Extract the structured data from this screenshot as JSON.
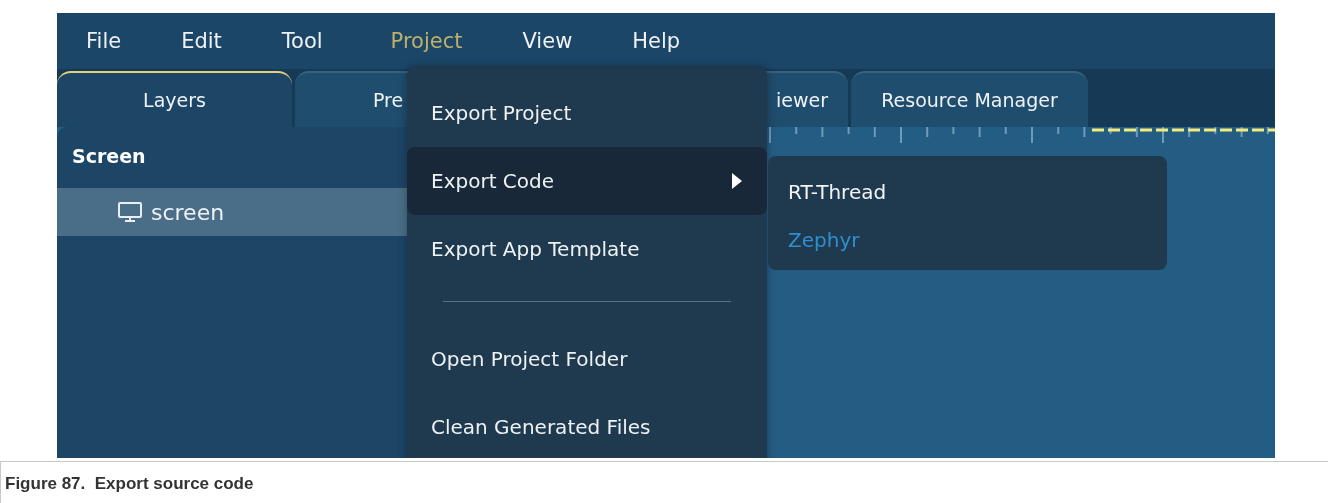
{
  "menubar": [
    {
      "label": "File",
      "selected": false
    },
    {
      "label": "Edit",
      "selected": false
    },
    {
      "label": "Tool",
      "selected": false
    },
    {
      "label": "Project",
      "selected": true
    },
    {
      "label": "View",
      "selected": false
    },
    {
      "label": "Help",
      "selected": false
    }
  ],
  "tabs": [
    {
      "label": "Layers",
      "selected": true
    },
    {
      "label": "Pre",
      "selected": false
    },
    {
      "label": "iewer",
      "selected": false
    },
    {
      "label": "Resource Manager",
      "selected": false
    }
  ],
  "layers_panel": {
    "header": "Screen",
    "items": [
      {
        "label": "screen",
        "selected": true
      }
    ]
  },
  "project_menu": {
    "items": [
      {
        "kind": "item",
        "label": "Export Project",
        "highlighted": false
      },
      {
        "kind": "submenu",
        "label": "Export Code",
        "highlighted": true
      },
      {
        "kind": "item",
        "label": "Export App Template",
        "highlighted": false
      },
      {
        "kind": "separator"
      },
      {
        "kind": "item",
        "label": "Open Project Folder",
        "highlighted": false
      },
      {
        "kind": "item",
        "label": "Clean Generated Files",
        "highlighted": false
      }
    ]
  },
  "export_code_submenu": {
    "items": [
      {
        "label": "RT-Thread",
        "highlighted": false
      },
      {
        "label": "Zephyr",
        "highlighted": true
      }
    ]
  },
  "caption": "Figure 87.  Export source code"
}
